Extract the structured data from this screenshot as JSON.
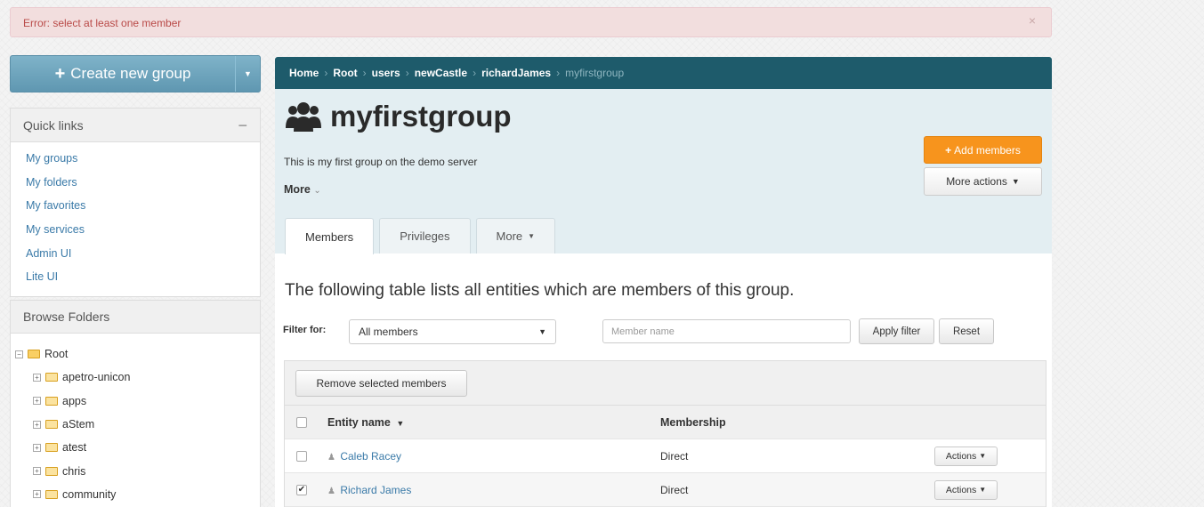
{
  "alert": {
    "message": "Error: select at least one member",
    "close": "×"
  },
  "sidebar": {
    "create_label": "Create new group",
    "quick_links": {
      "title": "Quick links",
      "collapse": "−",
      "items": [
        "My groups",
        "My folders",
        "My favorites",
        "My services",
        "Admin UI",
        "Lite UI"
      ]
    },
    "browse": {
      "title": "Browse Folders",
      "root": "Root",
      "children": [
        "apetro-unicon",
        "apps",
        "aStem",
        "atest",
        "chris",
        "community"
      ]
    }
  },
  "breadcrumb": {
    "items": [
      "Home",
      "Root",
      "users",
      "newCastle",
      "richardJames"
    ],
    "current": "myfirstgroup"
  },
  "group": {
    "name": "myfirstgroup",
    "description": "This is my first group on the demo server",
    "more_label": "More",
    "add_members": "Add members",
    "more_actions": "More actions"
  },
  "tabs": {
    "members": "Members",
    "privileges": "Privileges",
    "more": "More"
  },
  "members": {
    "intro": "The following table lists all entities which are members of this group.",
    "filter_label": "Filter for:",
    "filter_value": "All members",
    "member_placeholder": "Member name",
    "apply": "Apply filter",
    "reset": "Reset",
    "remove_selected": "Remove selected members",
    "columns": {
      "name": "Entity name",
      "membership": "Membership"
    },
    "rows": [
      {
        "name": "Caleb Racey",
        "membership": "Direct",
        "actions": "Actions",
        "checked": false
      },
      {
        "name": "Richard James",
        "membership": "Direct",
        "actions": "Actions",
        "checked": true
      }
    ]
  }
}
